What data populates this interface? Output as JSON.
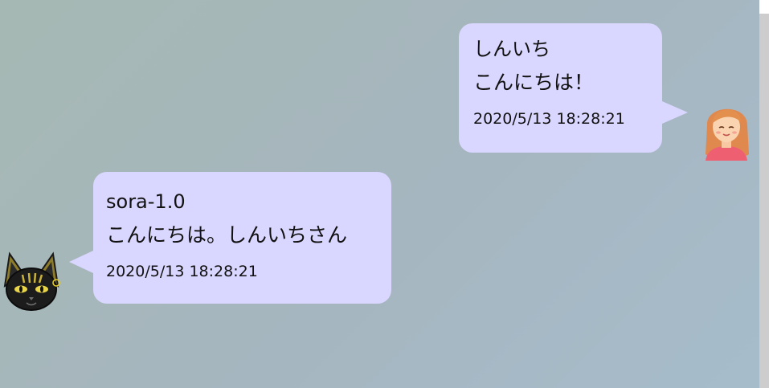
{
  "messages": [
    {
      "sender": "しんいち",
      "text": "こんにちは！",
      "timestamp": "2020/5/13 18:28:21",
      "avatar": "user-girl-avatar"
    },
    {
      "sender": "sora-1.0",
      "text": "こんにちは。しんいちさん",
      "timestamp": "2020/5/13 18:28:21",
      "avatar": "black-cat-bot-avatar"
    }
  ],
  "colors": {
    "bubble_background": "#d9d6ff",
    "chat_background_start": "#a6b8b3",
    "chat_background_end": "#a6bccb",
    "scrollbar": "#cdcdcd"
  }
}
